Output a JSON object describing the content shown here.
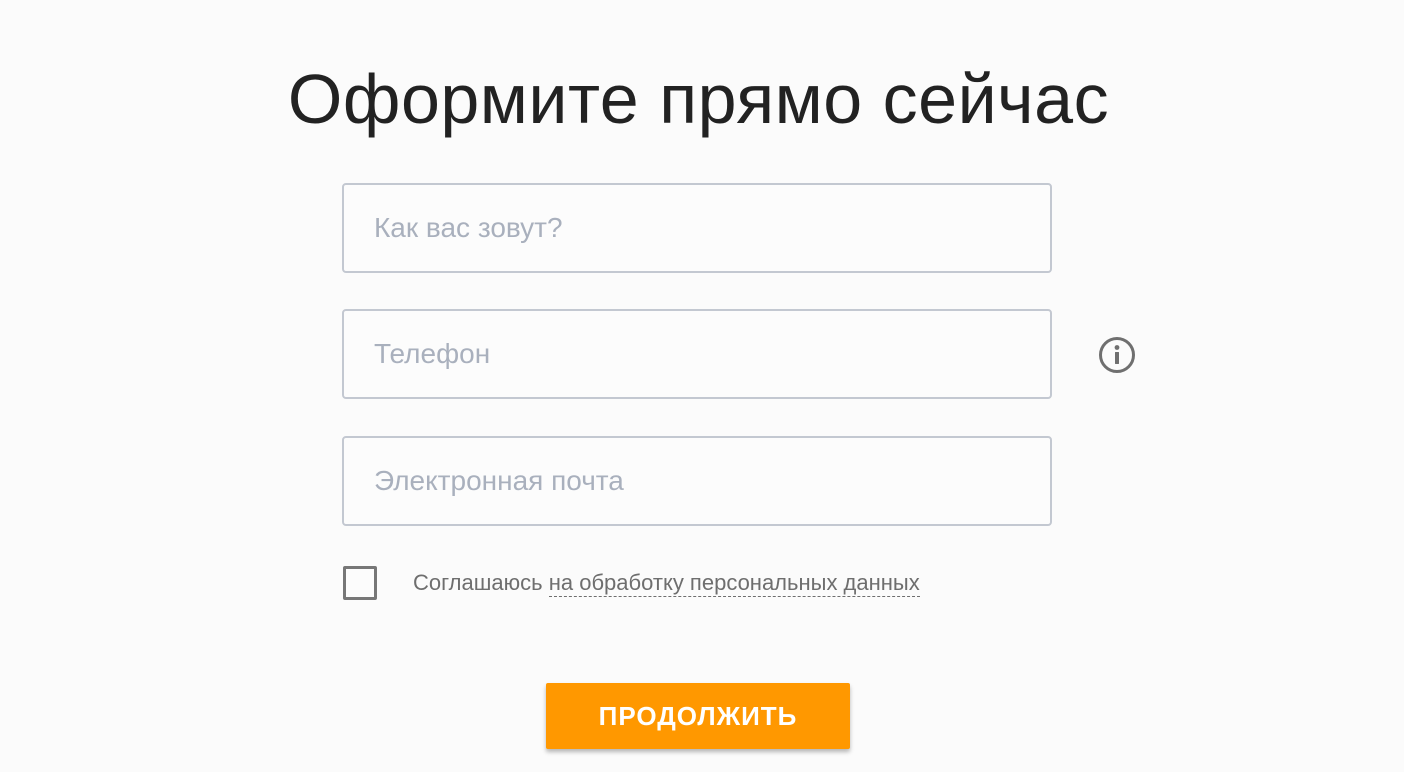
{
  "heading": {
    "title": "Оформите прямо сейчас"
  },
  "form": {
    "name_placeholder": "Как вас зовут?",
    "name_value": "",
    "phone_placeholder": "Телефон",
    "phone_value": "",
    "email_placeholder": "Электронная почта",
    "email_value": "",
    "phone_info_icon": "info-circle-icon"
  },
  "consent": {
    "checked": false,
    "text_prefix": "Соглашаюсь",
    "link_text": "на обработку персональных данных"
  },
  "submit": {
    "label": "ПРОДОЛЖИТЬ"
  },
  "colors": {
    "accent": "#ff9800",
    "field_border": "#c3c8d1",
    "placeholder": "#a9b0bd",
    "text_secondary": "#6e6e6e"
  }
}
